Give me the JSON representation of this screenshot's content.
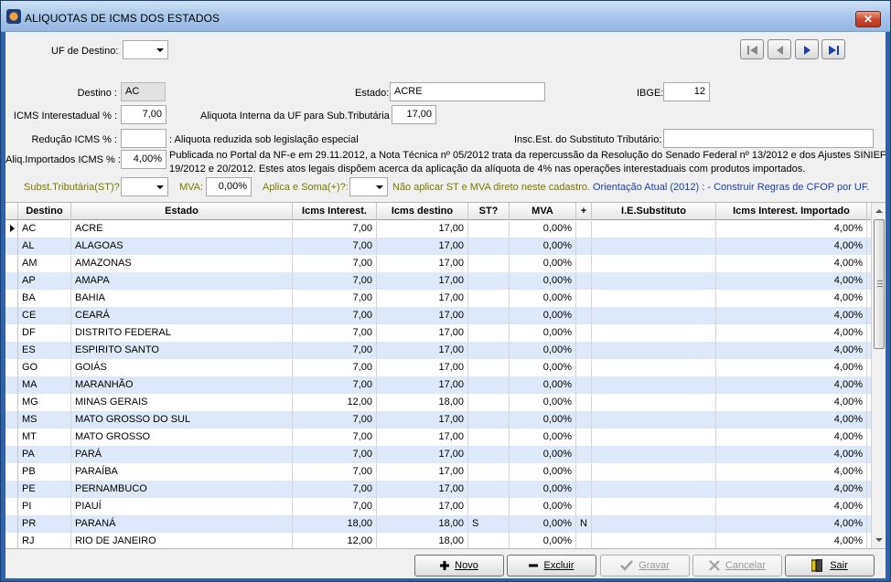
{
  "window": {
    "title": "ALIQUOTAS DE ICMS DOS ESTADOS",
    "close": "✕"
  },
  "filter": {
    "uf_label": "UF de Destino:",
    "uf_value": ""
  },
  "form": {
    "destino_label": "Destino :",
    "destino_value": "AC",
    "estado_label": "Estado:",
    "estado_value": "ACRE",
    "ibge_label": "IBGE:",
    "ibge_value": "12",
    "icms_inter_label": "ICMS Interestadual % :",
    "icms_inter_value": "7,00",
    "aliq_interna_label": "Aliquota Interna da UF para Sub.Tributária :",
    "aliq_interna_value": "17,00",
    "reducao_label": "Redução ICMS % :",
    "reducao_value": "",
    "reducao_note": ": Aliquota reduzida sob legislação especial",
    "insc_label": "Insc.Est. do Substituto Tributário:",
    "insc_value": "",
    "aliq_import_label": "Aliq.Importados ICMS % :",
    "aliq_import_value": "4,00%",
    "aliq_import_note_1": "Publicada no Portal da NF-e em 29.11.2012, a Nota Técnica nº 05/2012 trata da repercussão da Resolução do Senado Federal nº 13/2012 e dos Ajustes SINIEF",
    "aliq_import_note_2": "19/2012 e 20/2012. Estes atos legais dispõem acerca da aplicação da alíquota de 4% nas operações interestaduais com produtos importados.",
    "subst_label": "Subst.Tributária(ST)?",
    "subst_value": "",
    "mva_label": "MVA:",
    "mva_value": "0,00%",
    "aplica_label": "Aplica e Soma(+)?:",
    "aplica_value": "",
    "nao_aplicar_note": "Não aplicar ST e MVA direto neste cadastro.",
    "orientacao_note": "Orientação Atual (2012) : - Construir Regras de CFOP por UF."
  },
  "grid": {
    "columns": [
      "Destino",
      "Estado",
      "Icms Interest.",
      "Icms destino",
      "ST?",
      "MVA",
      "+",
      "I.E.Substituto",
      "Icms Interest. Importado"
    ],
    "rows": [
      [
        "AC",
        "ACRE",
        "7,00",
        "17,00",
        "",
        "0,00%",
        "",
        "",
        "4,00%"
      ],
      [
        "AL",
        "ALAGOAS",
        "7,00",
        "17,00",
        "",
        "0,00%",
        "",
        "",
        "4,00%"
      ],
      [
        "AM",
        "AMAZONAS",
        "7,00",
        "17,00",
        "",
        "0,00%",
        "",
        "",
        "4,00%"
      ],
      [
        "AP",
        "AMAPA",
        "7,00",
        "17,00",
        "",
        "0,00%",
        "",
        "",
        "4,00%"
      ],
      [
        "BA",
        "BAHIA",
        "7,00",
        "17,00",
        "",
        "0,00%",
        "",
        "",
        "4,00%"
      ],
      [
        "CE",
        "CEARÁ",
        "7,00",
        "17,00",
        "",
        "0,00%",
        "",
        "",
        "4,00%"
      ],
      [
        "DF",
        "DISTRITO FEDERAL",
        "7,00",
        "17,00",
        "",
        "0,00%",
        "",
        "",
        "4,00%"
      ],
      [
        "ES",
        "ESPIRITO SANTO",
        "7,00",
        "17,00",
        "",
        "0,00%",
        "",
        "",
        "4,00%"
      ],
      [
        "GO",
        "GOIÁS",
        "7,00",
        "17,00",
        "",
        "0,00%",
        "",
        "",
        "4,00%"
      ],
      [
        "MA",
        "MARANHÃO",
        "7,00",
        "17,00",
        "",
        "0,00%",
        "",
        "",
        "4,00%"
      ],
      [
        "MG",
        "MINAS GERAIS",
        "12,00",
        "18,00",
        "",
        "0,00%",
        "",
        "",
        "4,00%"
      ],
      [
        "MS",
        "MATO GROSSO DO SUL",
        "7,00",
        "17,00",
        "",
        "0,00%",
        "",
        "",
        "4,00%"
      ],
      [
        "MT",
        "MATO GROSSO",
        "7,00",
        "17,00",
        "",
        "0,00%",
        "",
        "",
        "4,00%"
      ],
      [
        "PA",
        "PARÁ",
        "7,00",
        "17,00",
        "",
        "0,00%",
        "",
        "",
        "4,00%"
      ],
      [
        "PB",
        "PARAÍBA",
        "7,00",
        "17,00",
        "",
        "0,00%",
        "",
        "",
        "4,00%"
      ],
      [
        "PE",
        "PERNAMBUCO",
        "7,00",
        "17,00",
        "",
        "0,00%",
        "",
        "",
        "4,00%"
      ],
      [
        "PI",
        "PIAUÍ",
        "7,00",
        "17,00",
        "",
        "0,00%",
        "",
        "",
        "4,00%"
      ],
      [
        "PR",
        "PARANÁ",
        "18,00",
        "18,00",
        "S",
        "0,00%",
        "N",
        "",
        "4,00%"
      ],
      [
        "RJ",
        "RIO DE JANEIRO",
        "12,00",
        "18,00",
        "",
        "0,00%",
        "",
        "",
        "4,00%"
      ]
    ]
  },
  "buttons": {
    "novo": "Novo",
    "excluir": "Excluir",
    "gravar": "Gravar",
    "cancelar": "Cancelar",
    "sair": "Sair"
  },
  "colors": {
    "title_bar": "#a9c7ec",
    "row_alt": "#dde9f8",
    "window_frame": "#2f63a8",
    "olive_text": "#7a7a00",
    "link_blue": "#1f3fb0"
  },
  "icons": {
    "first": "first-record-icon",
    "prev": "previous-record-icon",
    "next": "next-record-icon",
    "last": "last-record-icon"
  }
}
